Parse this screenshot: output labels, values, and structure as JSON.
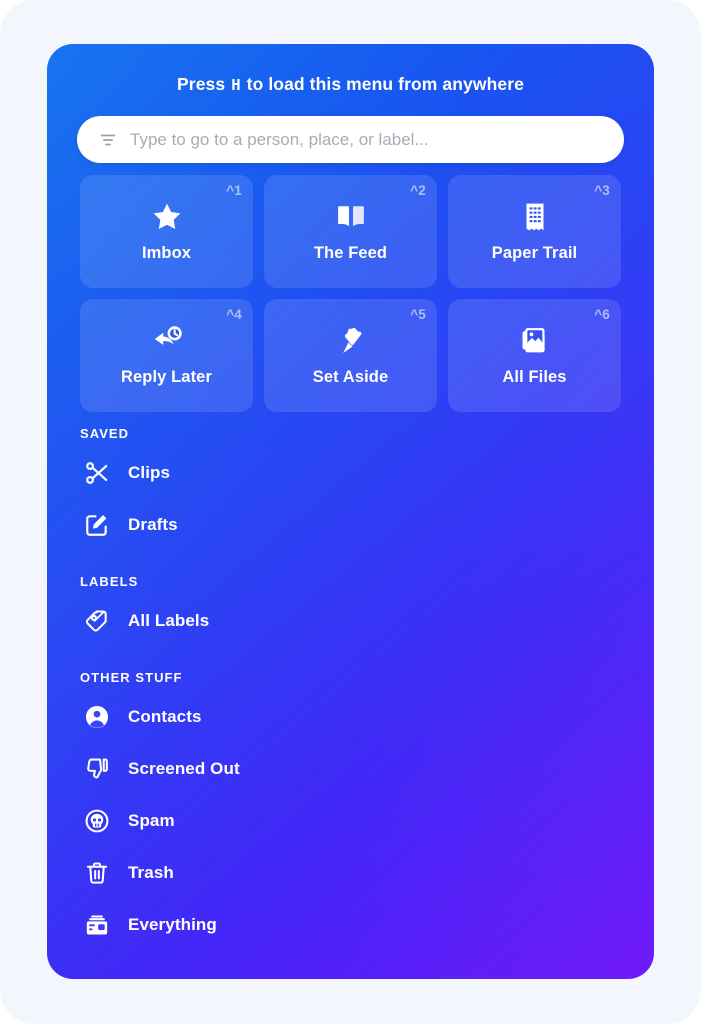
{
  "theme": {
    "panel_gradient_start": "#0a6cef",
    "panel_gradient_end": "#6a0ff9",
    "backdrop": "#f3f6fc",
    "text_on_panel": "#ffffff",
    "shortcut_text": "rgba(255,255,255,0.58)"
  },
  "hint": {
    "prefix": "Press",
    "key": "H",
    "suffix": "to load this menu from anywhere"
  },
  "search": {
    "placeholder": "Type to go to a person, place, or label...",
    "value": "",
    "icon": "filter-icon"
  },
  "tiles": [
    {
      "label": "Imbox",
      "shortcut": "^1",
      "icon": "star-icon"
    },
    {
      "label": "The Feed",
      "shortcut": "^2",
      "icon": "open-book-icon"
    },
    {
      "label": "Paper Trail",
      "shortcut": "^3",
      "icon": "receipt-icon"
    },
    {
      "label": "Reply Later",
      "shortcut": "^4",
      "icon": "reply-clock-icon"
    },
    {
      "label": "Set Aside",
      "shortcut": "^5",
      "icon": "pin-icon"
    },
    {
      "label": "All Files",
      "shortcut": "^6",
      "icon": "photo-stack-icon"
    }
  ],
  "sections": [
    {
      "heading": "SAVED",
      "items": [
        {
          "label": "Clips",
          "icon": "scissors-icon"
        },
        {
          "label": "Drafts",
          "icon": "pencil-square-icon"
        }
      ]
    },
    {
      "heading": "LABELS",
      "items": [
        {
          "label": "All Labels",
          "icon": "tag-icon"
        }
      ]
    },
    {
      "heading": "OTHER STUFF",
      "items": [
        {
          "label": "Contacts",
          "icon": "person-circle-icon"
        },
        {
          "label": "Screened Out",
          "icon": "thumbs-down-icon"
        },
        {
          "label": "Spam",
          "icon": "skull-circle-icon"
        },
        {
          "label": "Trash",
          "icon": "trash-icon"
        },
        {
          "label": "Everything",
          "icon": "archive-box-icon"
        }
      ]
    }
  ]
}
